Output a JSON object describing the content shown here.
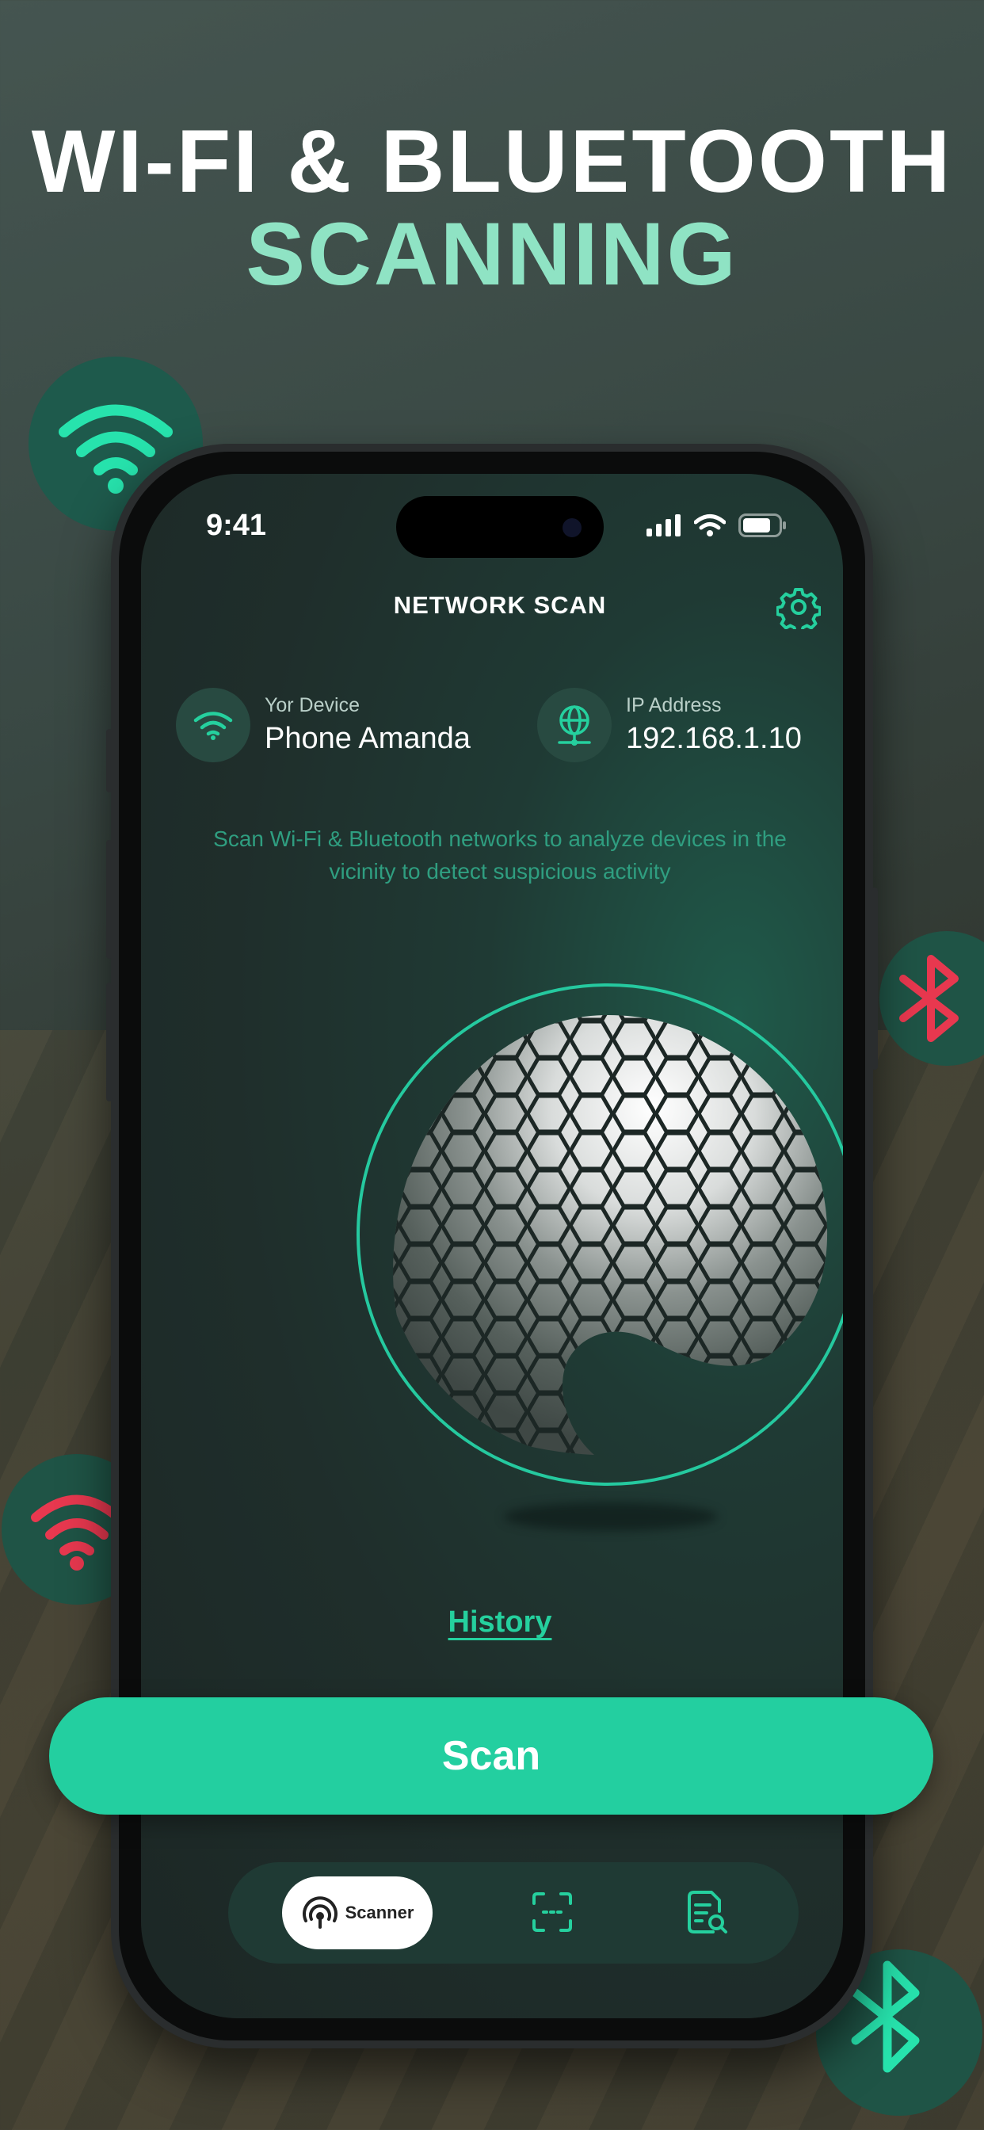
{
  "headline": {
    "line1": "WI-FI & BLUETOOTH",
    "line2": "SCANNING"
  },
  "status_bar": {
    "time": "9:41"
  },
  "header": {
    "title": "NETWORK SCAN",
    "settings_icon": "gear-icon"
  },
  "device": {
    "label": "Yor Device",
    "value": "Phone Amanda",
    "icon": "wifi-icon"
  },
  "ip": {
    "label": "IP Address",
    "value": "192.168.1.10",
    "icon": "globe-network-icon"
  },
  "description": "Scan Wi-Fi & Bluetooth networks to analyze devices in the vicinity to detect suspicious activity",
  "history_link": "History",
  "scan_button": "Scan",
  "tab_bar": {
    "tabs": [
      {
        "label": "Scanner",
        "icon": "radar-icon",
        "active": true
      },
      {
        "label": "",
        "icon": "scan-frame-icon",
        "active": false
      },
      {
        "label": "",
        "icon": "document-search-icon",
        "active": false
      }
    ]
  },
  "colors": {
    "accent": "#23cfa0",
    "headline_accent": "#8fe3c4",
    "alert": "#e8384f",
    "screen_bg": "#1f2e2b"
  }
}
